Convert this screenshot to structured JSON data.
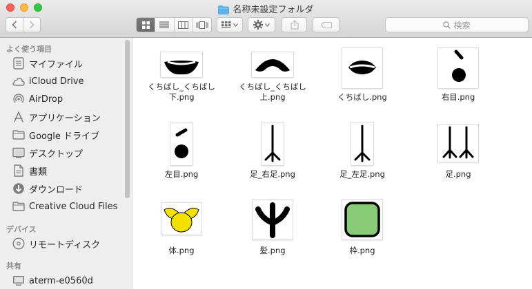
{
  "window": {
    "title": "名称未設定フォルダ"
  },
  "toolbar": {
    "search_placeholder": "検索"
  },
  "sidebar": {
    "sections": [
      {
        "header": "よく使う項目",
        "items": [
          {
            "label": "マイファイル",
            "icon": "all-files-icon"
          },
          {
            "label": "iCloud Drive",
            "icon": "cloud-icon"
          },
          {
            "label": "AirDrop",
            "icon": "airdrop-icon"
          },
          {
            "label": "アプリケーション",
            "icon": "applications-icon"
          },
          {
            "label": "Google ドライブ",
            "icon": "folder-icon"
          },
          {
            "label": "デスクトップ",
            "icon": "desktop-icon"
          },
          {
            "label": "書類",
            "icon": "documents-icon"
          },
          {
            "label": "ダウンロード",
            "icon": "downloads-icon"
          },
          {
            "label": "Creative Cloud Files",
            "icon": "folder-icon"
          }
        ]
      },
      {
        "header": "デバイス",
        "items": [
          {
            "label": "リモートディスク",
            "icon": "disc-icon"
          }
        ]
      },
      {
        "header": "共有",
        "items": [
          {
            "label": "aterm-e0560d",
            "icon": "computer-icon"
          }
        ]
      }
    ]
  },
  "files": [
    {
      "name": "くちばし_くちばし下.png",
      "line1": "くちばし_くちばし",
      "line2": "下.png",
      "kind": "beak-lower"
    },
    {
      "name": "くちばし_くちばし上.png",
      "line1": "くちばし_くちばし",
      "line2": "上.png",
      "kind": "beak-upper"
    },
    {
      "name": "くちばし.png",
      "line1": "くちばし.png",
      "line2": "",
      "kind": "beak"
    },
    {
      "name": "右目.png",
      "line1": "右目.png",
      "line2": "",
      "kind": "eye-right"
    },
    {
      "name": "左目.png",
      "line1": "左目.png",
      "line2": "",
      "kind": "eye-left"
    },
    {
      "name": "足_右足.png",
      "line1": "足_右足.png",
      "line2": "",
      "kind": "foot"
    },
    {
      "name": "足_左足.png",
      "line1": "足_左足.png",
      "line2": "",
      "kind": "foot"
    },
    {
      "name": "足.png",
      "line1": "足.png",
      "line2": "",
      "kind": "feet"
    },
    {
      "name": "体.png",
      "line1": "体.png",
      "line2": "",
      "kind": "body"
    },
    {
      "name": "髪.png",
      "line1": "髪.png",
      "line2": "",
      "kind": "hair"
    },
    {
      "name": "枠.png",
      "line1": "枠.png",
      "line2": "",
      "kind": "frame"
    }
  ],
  "colors": {
    "folder_blue": "#5ab4f0",
    "body_yellow": "#f5e100",
    "frame_green": "#88cc77",
    "selected_segment": "#6f6e6f"
  }
}
